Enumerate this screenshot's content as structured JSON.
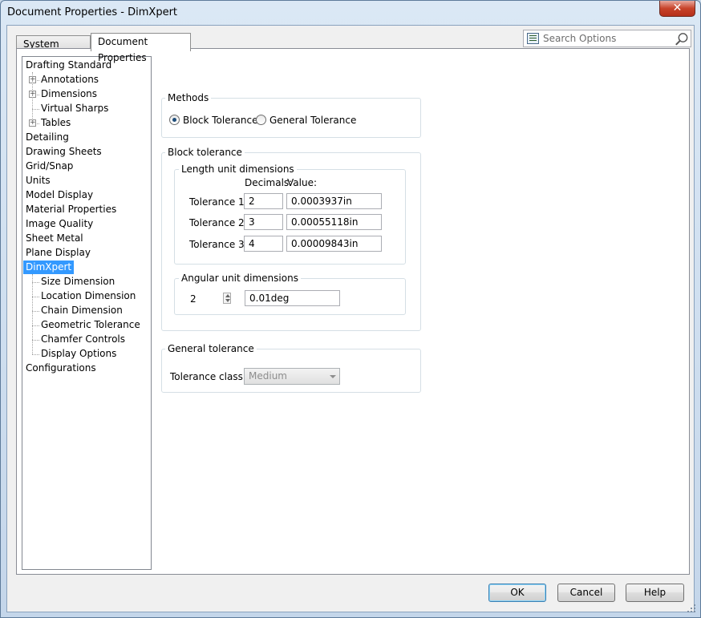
{
  "window": {
    "title": "Document Properties - DimXpert",
    "close_label": "✕"
  },
  "tabs": [
    {
      "label": "System Options",
      "active": false
    },
    {
      "label": "Document Properties",
      "active": true
    }
  ],
  "search": {
    "placeholder": "Search Options"
  },
  "tree": {
    "items": [
      {
        "label": "Drafting Standard",
        "level": 0,
        "expander": false
      },
      {
        "label": "Annotations",
        "level": 1,
        "expander": true
      },
      {
        "label": "Dimensions",
        "level": 1,
        "expander": true
      },
      {
        "label": "Virtual Sharps",
        "level": 1,
        "expander": false
      },
      {
        "label": "Tables",
        "level": 1,
        "expander": true
      },
      {
        "label": "Detailing",
        "level": 0,
        "expander": false
      },
      {
        "label": "Drawing Sheets",
        "level": 0,
        "expander": false
      },
      {
        "label": "Grid/Snap",
        "level": 0,
        "expander": false
      },
      {
        "label": "Units",
        "level": 0,
        "expander": false
      },
      {
        "label": "Model Display",
        "level": 0,
        "expander": false
      },
      {
        "label": "Material Properties",
        "level": 0,
        "expander": false
      },
      {
        "label": "Image Quality",
        "level": 0,
        "expander": false
      },
      {
        "label": "Sheet Metal",
        "level": 0,
        "expander": false
      },
      {
        "label": "Plane Display",
        "level": 0,
        "expander": false
      },
      {
        "label": "DimXpert",
        "level": 0,
        "expander": false,
        "selected": true
      },
      {
        "label": "Size Dimension",
        "level": 1,
        "expander": false
      },
      {
        "label": "Location Dimension",
        "level": 1,
        "expander": false
      },
      {
        "label": "Chain Dimension",
        "level": 1,
        "expander": false
      },
      {
        "label": "Geometric Tolerance",
        "level": 1,
        "expander": false
      },
      {
        "label": "Chamfer Controls",
        "level": 1,
        "expander": false
      },
      {
        "label": "Display Options",
        "level": 1,
        "expander": false
      },
      {
        "label": "Configurations",
        "level": 0,
        "expander": false
      }
    ]
  },
  "methods": {
    "title": "Methods",
    "options": [
      {
        "label": "Block Tolerance",
        "checked": true
      },
      {
        "label": "General Tolerance",
        "checked": false
      }
    ]
  },
  "block_tolerance": {
    "title": "Block tolerance",
    "length": {
      "title": "Length unit dimensions",
      "col_decimals": "Decimals:",
      "col_value": "Value:",
      "rows": [
        {
          "label": "Tolerance 1:",
          "decimals": "2",
          "value": "0.0003937in"
        },
        {
          "label": "Tolerance 2:",
          "decimals": "3",
          "value": "0.00055118in"
        },
        {
          "label": "Tolerance 3:",
          "decimals": "4",
          "value": "0.00009843in"
        }
      ]
    },
    "angular": {
      "title": "Angular unit dimensions",
      "decimals": "2",
      "value": "0.01deg"
    }
  },
  "general_tolerance": {
    "title": "General tolerance",
    "class_label": "Tolerance class:",
    "class_value": "Medium"
  },
  "buttons": {
    "ok": "OK",
    "cancel": "Cancel",
    "help": "Help"
  }
}
